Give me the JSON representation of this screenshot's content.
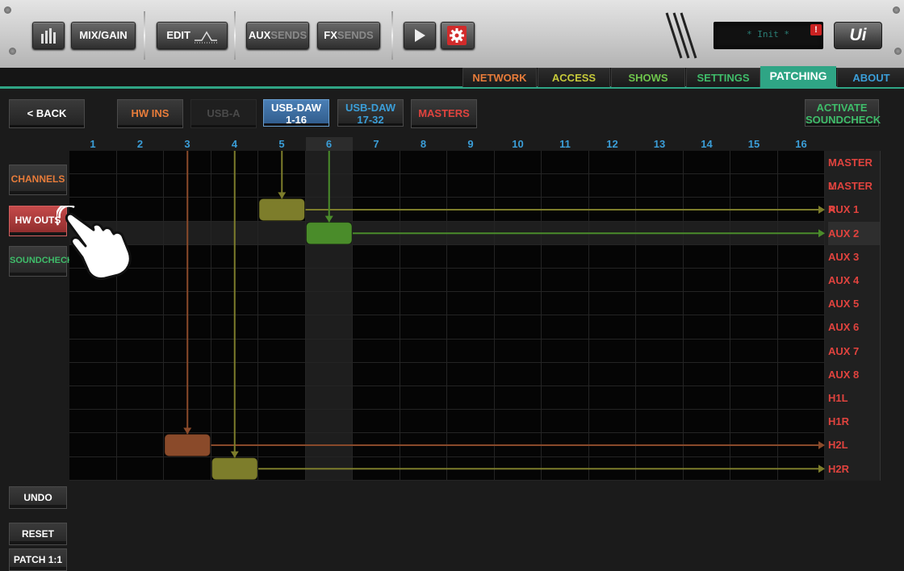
{
  "toolbar": {
    "meters_icon": "meters-icon",
    "mix_gain": "MIX/GAIN",
    "edit": "EDIT",
    "aux_a": "AUX",
    "aux_b": "SENDS",
    "fx_a": "FX",
    "fx_b": "SENDS",
    "lcd_text": "* Init *",
    "alert": "!",
    "logo": "Ui"
  },
  "tabs": [
    {
      "label": "NETWORK",
      "color": "#e87c3a"
    },
    {
      "label": "ACCESS",
      "color": "#c6c93a"
    },
    {
      "label": "SHOWS",
      "color": "#6ec44c"
    },
    {
      "label": "SETTINGS",
      "color": "#3fbd6a"
    },
    {
      "label": "PATCHING",
      "color": "#ffffff",
      "active": true
    },
    {
      "label": "ABOUT",
      "color": "#3b9ed8"
    }
  ],
  "subbar": {
    "back": "< BACK",
    "hw_ins": "HW INS",
    "usb_a": "USB-A",
    "usb_daw_1_l1": "USB-DAW",
    "usb_daw_1_l2": "1-16",
    "usb_daw_2_l1": "USB-DAW",
    "usb_daw_2_l2": "17-32",
    "masters": "MASTERS",
    "activate_l1": "ACTIVATE",
    "activate_l2": "SOUNDCHECK"
  },
  "left": {
    "channels": "CHANNELS",
    "hw_outs": "HW OUTS",
    "soundcheck": "SOUNDCHECK",
    "undo": "UNDO",
    "reset": "RESET",
    "patch": "PATCH 1:1"
  },
  "columns": [
    "1",
    "2",
    "3",
    "4",
    "5",
    "6",
    "7",
    "8",
    "9",
    "10",
    "11",
    "12",
    "13",
    "14",
    "15",
    "16"
  ],
  "rows": [
    "MASTER L",
    "MASTER R",
    "AUX 1",
    "AUX 2",
    "AUX 3",
    "AUX 4",
    "AUX 5",
    "AUX 6",
    "AUX 7",
    "AUX 8",
    "H1L",
    "H1R",
    "H2L",
    "H2R"
  ],
  "selected_column": "6",
  "selected_row": "AUX 2",
  "patches": [
    {
      "column": "5",
      "row": "AUX 1",
      "color": "#7d7d2b"
    },
    {
      "column": "6",
      "row": "AUX 2",
      "color": "#4a8c2a"
    },
    {
      "column": "3",
      "row": "H2L",
      "color": "#8a4a2a"
    },
    {
      "column": "4",
      "row": "H2R",
      "color": "#7d7d2b"
    }
  ],
  "colors": {
    "accent": "#2fa585",
    "row_label": "#e0433e",
    "column_label": "#3b9ed8"
  }
}
